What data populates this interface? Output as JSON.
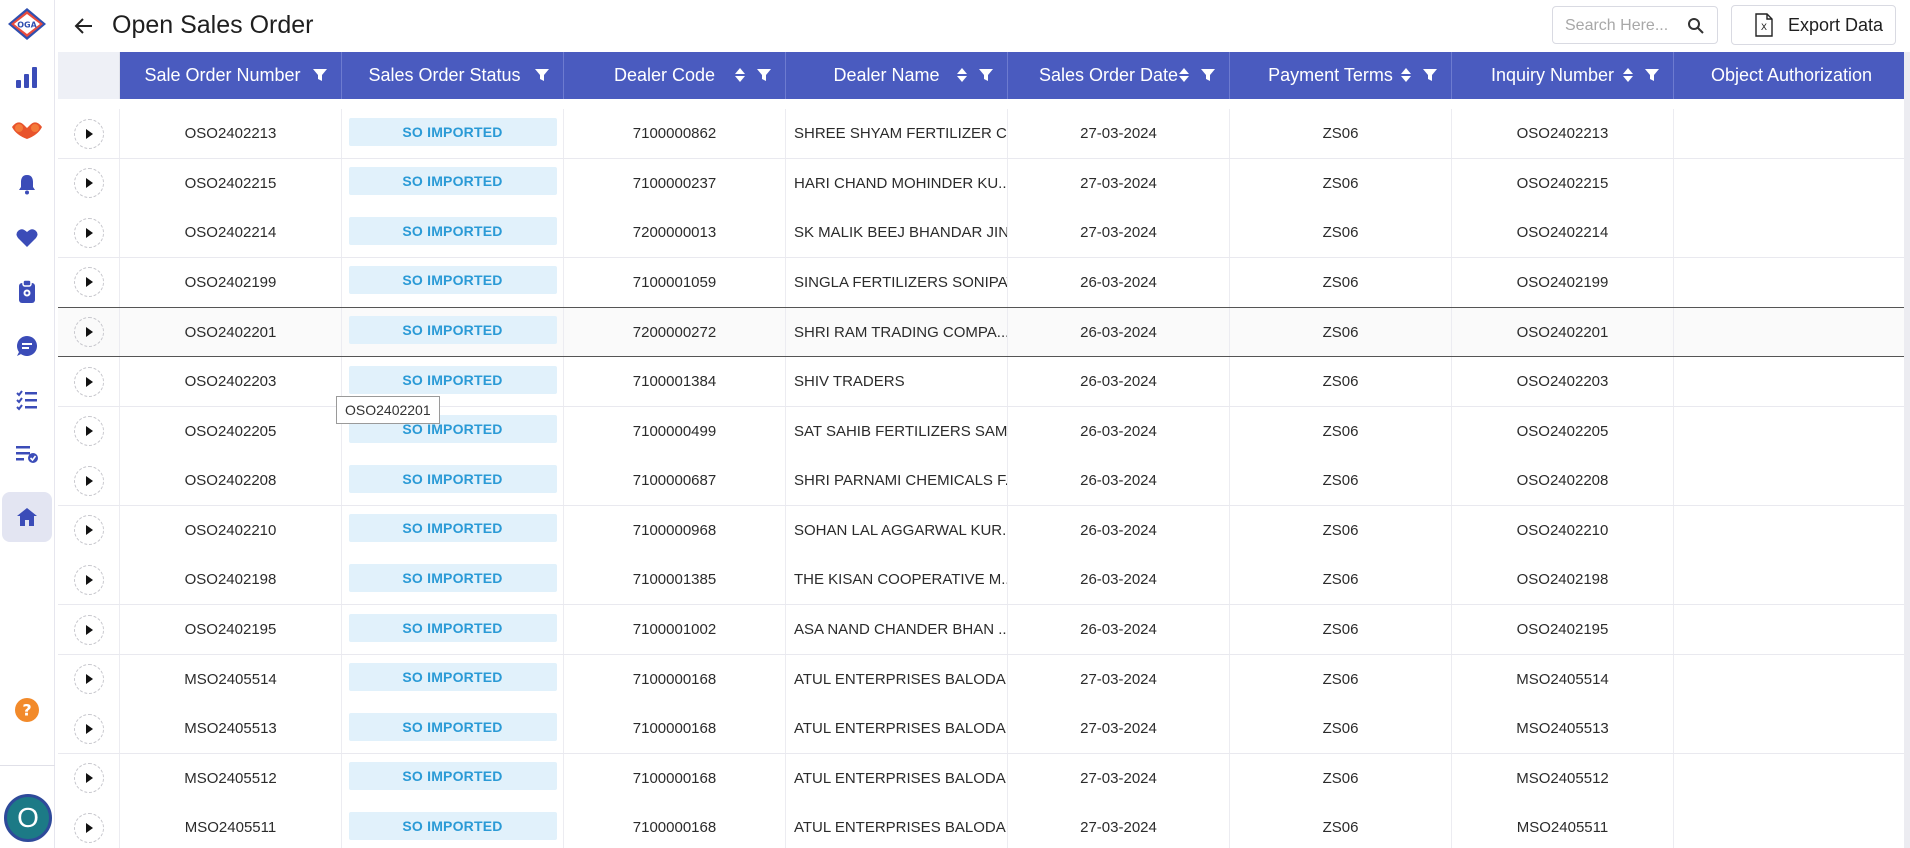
{
  "app": {
    "logo": "OGA"
  },
  "page": {
    "title": "Open Sales Order"
  },
  "search": {
    "placeholder": "Search Here..."
  },
  "export": {
    "label": "Export Data"
  },
  "sidebar": {
    "icons": [
      "bar-chart-icon",
      "handshake-icon",
      "bell-icon",
      "heart-icon",
      "clipboard-icon",
      "chat-doc-icon",
      "checklist-icon",
      "approved-list-icon",
      "home-icon"
    ],
    "active": "home-icon",
    "help_icon": "help-icon",
    "avatar_letter": "O"
  },
  "colors": {
    "header_bg": "#4a5bbf",
    "badge_bg": "#e1f1fb",
    "badge_text": "#2a9ad6"
  },
  "table": {
    "columns": [
      {
        "label": "Sale Order Number",
        "sort": false,
        "filter": true
      },
      {
        "label": "Sales Order Status",
        "sort": false,
        "filter": true
      },
      {
        "label": "Dealer Code",
        "sort": true,
        "filter": true
      },
      {
        "label": "Dealer Name",
        "sort": true,
        "filter": true
      },
      {
        "label": "Sales Order Date",
        "sort": true,
        "filter": true
      },
      {
        "label": "Payment Terms",
        "sort": true,
        "filter": true
      },
      {
        "label": "Inquiry Number",
        "sort": true,
        "filter": true
      },
      {
        "label": "Object Authorization",
        "sort": false,
        "filter": false
      }
    ],
    "rows": [
      {
        "order": "OSO2402213",
        "status": "SO IMPORTED",
        "code": "7100000862",
        "name": "SHREE SHYAM FERTILIZER CO...",
        "date": "27-03-2024",
        "terms": "ZS06",
        "inquiry": "OSO2402213"
      },
      {
        "order": "OSO2402215",
        "status": "SO IMPORTED",
        "code": "7100000237",
        "name": "HARI CHAND MOHINDER KU...",
        "date": "27-03-2024",
        "terms": "ZS06",
        "inquiry": "OSO2402215"
      },
      {
        "order": "OSO2402214",
        "status": "SO IMPORTED",
        "code": "7200000013",
        "name": "SK MALIK BEEJ BHANDAR JIND",
        "date": "27-03-2024",
        "terms": "ZS06",
        "inquiry": "OSO2402214"
      },
      {
        "order": "OSO2402199",
        "status": "SO IMPORTED",
        "code": "7100001059",
        "name": "SINGLA FERTILIZERS SONIPAT",
        "date": "26-03-2024",
        "terms": "ZS06",
        "inquiry": "OSO2402199"
      },
      {
        "order": "OSO2402201",
        "status": "SO IMPORTED",
        "code": "7200000272",
        "name": "SHRI RAM TRADING COMPA...",
        "date": "26-03-2024",
        "terms": "ZS06",
        "inquiry": "OSO2402201"
      },
      {
        "order": "OSO2402203",
        "status": "SO IMPORTED",
        "code": "7100001384",
        "name": "SHIV TRADERS",
        "date": "26-03-2024",
        "terms": "ZS06",
        "inquiry": "OSO2402203"
      },
      {
        "order": "OSO2402205",
        "status": "SO IMPORTED",
        "code": "7100000499",
        "name": "SAT SAHIB FERTILIZERS SAM...",
        "date": "26-03-2024",
        "terms": "ZS06",
        "inquiry": "OSO2402205"
      },
      {
        "order": "OSO2402208",
        "status": "SO IMPORTED",
        "code": "7100000687",
        "name": "SHRI PARNAMI CHEMICALS F...",
        "date": "26-03-2024",
        "terms": "ZS06",
        "inquiry": "OSO2402208"
      },
      {
        "order": "OSO2402210",
        "status": "SO IMPORTED",
        "code": "7100000968",
        "name": "SOHAN LAL AGGARWAL KUR...",
        "date": "26-03-2024",
        "terms": "ZS06",
        "inquiry": "OSO2402210"
      },
      {
        "order": "OSO2402198",
        "status": "SO IMPORTED",
        "code": "7100001385",
        "name": "THE KISAN COOPERATIVE M...",
        "date": "26-03-2024",
        "terms": "ZS06",
        "inquiry": "OSO2402198"
      },
      {
        "order": "OSO2402195",
        "status": "SO IMPORTED",
        "code": "7100001002",
        "name": "ASA NAND CHANDER BHAN ...",
        "date": "26-03-2024",
        "terms": "ZS06",
        "inquiry": "OSO2402195"
      },
      {
        "order": "MSO2405514",
        "status": "SO IMPORTED",
        "code": "7100000168",
        "name": "ATUL ENTERPRISES BALODA ...",
        "date": "27-03-2024",
        "terms": "ZS06",
        "inquiry": "MSO2405514"
      },
      {
        "order": "MSO2405513",
        "status": "SO IMPORTED",
        "code": "7100000168",
        "name": "ATUL ENTERPRISES BALODA ...",
        "date": "27-03-2024",
        "terms": "ZS06",
        "inquiry": "MSO2405513"
      },
      {
        "order": "MSO2405512",
        "status": "SO IMPORTED",
        "code": "7100000168",
        "name": "ATUL ENTERPRISES BALODA ...",
        "date": "27-03-2024",
        "terms": "ZS06",
        "inquiry": "MSO2405512"
      },
      {
        "order": "MSO2405511",
        "status": "SO IMPORTED",
        "code": "7100000168",
        "name": "ATUL ENTERPRISES BALODA ...",
        "date": "27-03-2024",
        "terms": "ZS06",
        "inquiry": "MSO2405511"
      }
    ],
    "hovered_row": 4,
    "tooltip": "OSO2402201"
  }
}
